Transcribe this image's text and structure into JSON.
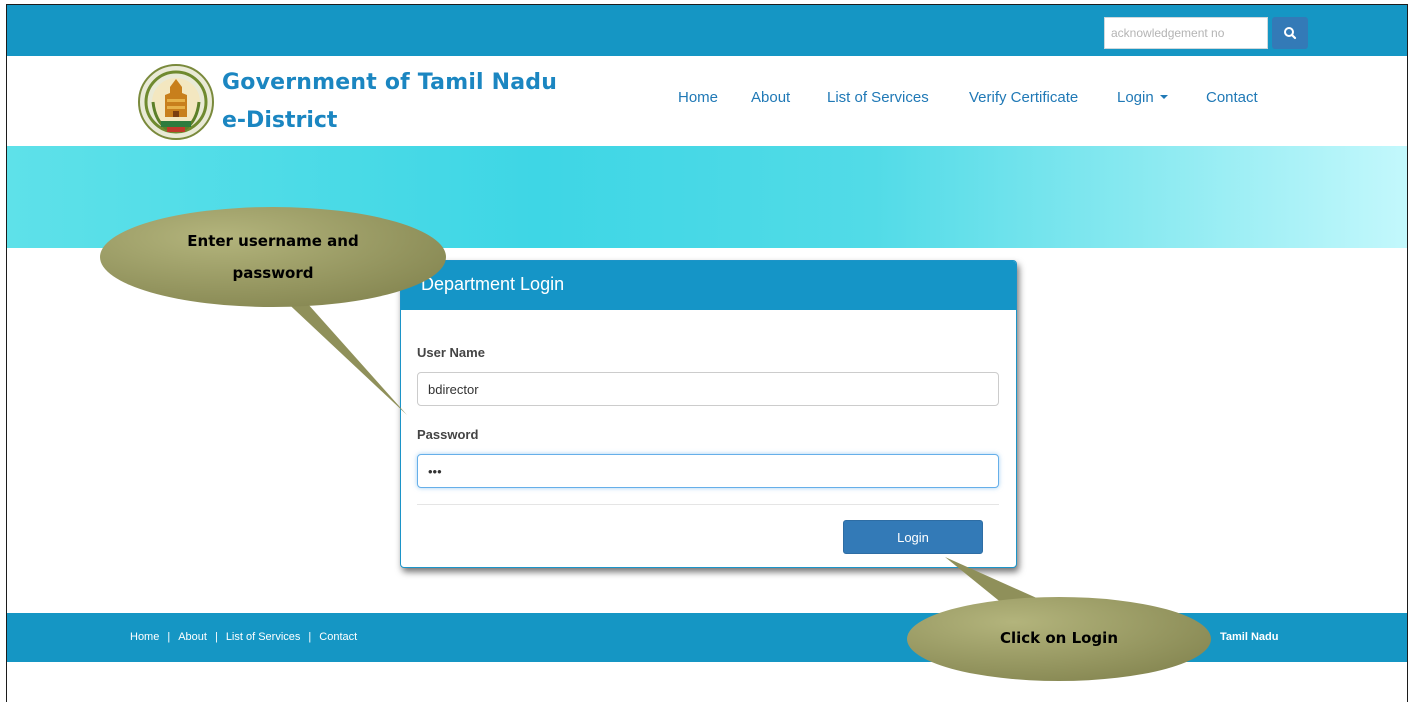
{
  "colors": {
    "topbar": "#1596c4",
    "brand_text": "#1b86c1",
    "nav_text": "#2079b6",
    "panel_header": "#1595c7",
    "primary_button": "#337ab7",
    "callout_fill": "#9a9b66"
  },
  "search": {
    "placeholder": "acknowledgement no",
    "icon": "search-icon"
  },
  "header": {
    "title": "Government of Tamil Nadu",
    "subtitle": "e-District",
    "logo_icon": "tamil-nadu-emblem-icon"
  },
  "nav": {
    "items": [
      "Home",
      "About",
      "List of Services",
      "Verify Certificate",
      "Login",
      "Contact"
    ]
  },
  "login_panel": {
    "title": "Department Login",
    "username_label": "User Name",
    "username_value": "bdirector",
    "password_label": "Password",
    "password_value": "•••",
    "submit_label": "Login"
  },
  "footer": {
    "links": [
      "Home",
      "About",
      "List of Services",
      "Contact"
    ],
    "right_text": "Tamil Nadu"
  },
  "callouts": {
    "credentials": "Enter username and\npassword",
    "login": "Click on Login"
  }
}
